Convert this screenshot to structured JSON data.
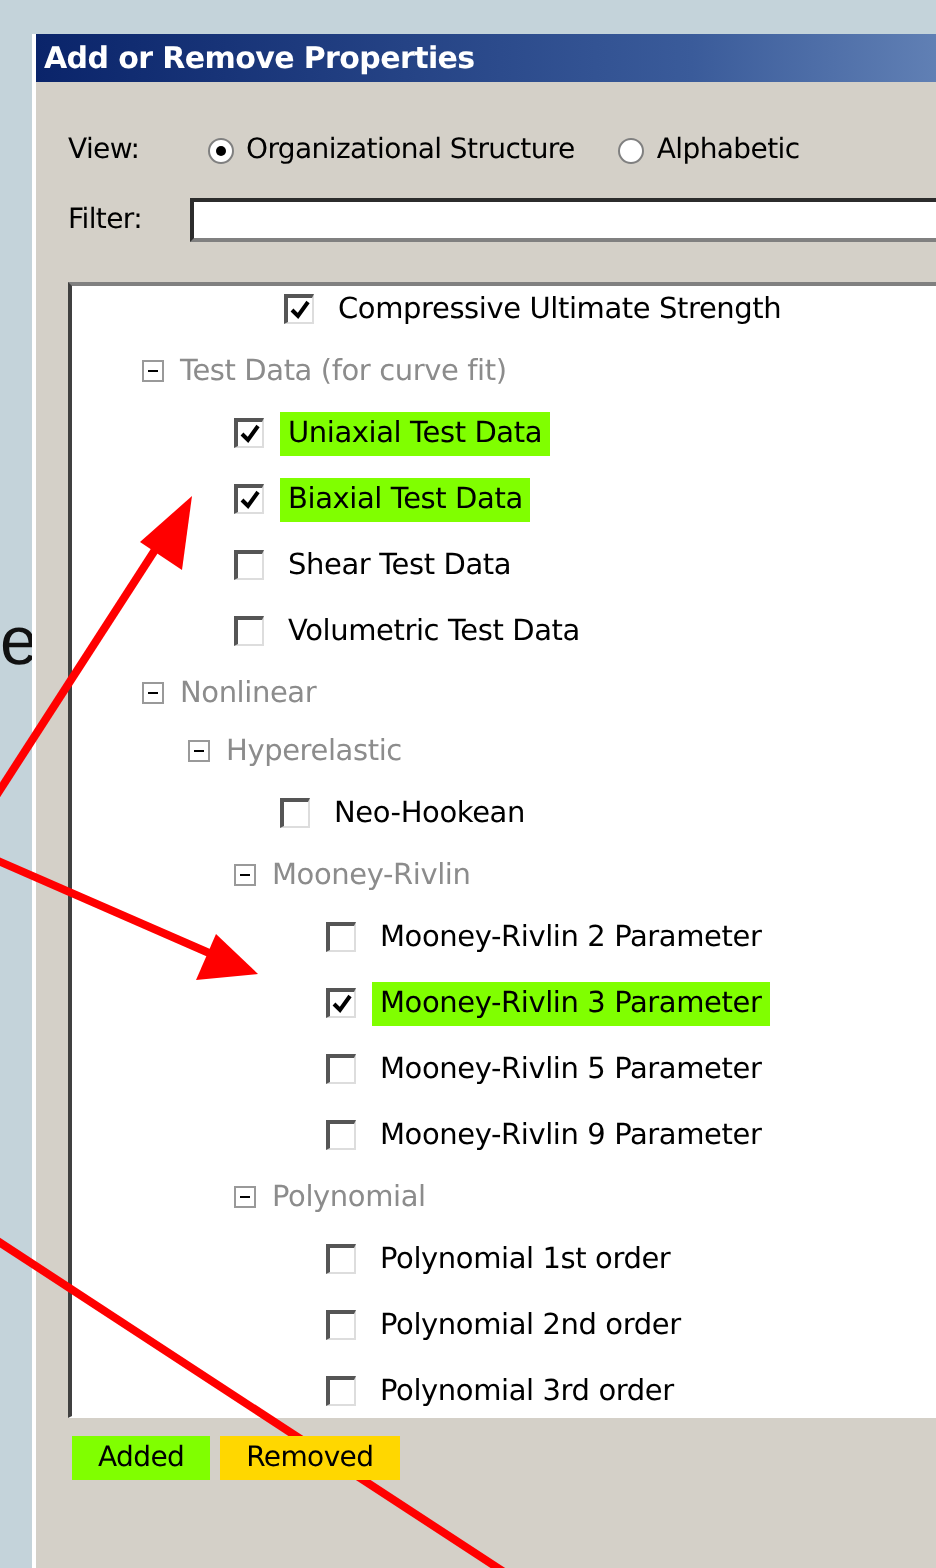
{
  "slide_text": "e",
  "window": {
    "title": "Add or Remove Properties"
  },
  "view": {
    "label": "View:",
    "options": [
      {
        "label": "Organizational Structure",
        "selected": true
      },
      {
        "label": "Alphabetic",
        "selected": false
      }
    ]
  },
  "filter": {
    "label": "Filter:"
  },
  "tree": [
    {
      "kind": "check",
      "label": "Compressive Ultimate Strength",
      "checked": true,
      "added": false
    },
    {
      "kind": "group",
      "label": "Test Data (for curve fit)",
      "expanded": true,
      "children": [
        {
          "kind": "check",
          "label": "Uniaxial Test Data",
          "checked": true,
          "added": true
        },
        {
          "kind": "check",
          "label": "Biaxial Test Data",
          "checked": true,
          "added": true
        },
        {
          "kind": "check",
          "label": "Shear Test Data",
          "checked": false,
          "added": false
        },
        {
          "kind": "check",
          "label": "Volumetric Test Data",
          "checked": false,
          "added": false
        }
      ]
    },
    {
      "kind": "group",
      "label": "Nonlinear",
      "expanded": true,
      "children": [
        {
          "kind": "group",
          "label": "Hyperelastic",
          "expanded": true,
          "children": [
            {
              "kind": "check",
              "label": "Neo-Hookean",
              "checked": false,
              "added": false
            },
            {
              "kind": "group",
              "label": "Mooney-Rivlin",
              "expanded": true,
              "children": [
                {
                  "kind": "check",
                  "label": "Mooney-Rivlin 2 Parameter",
                  "checked": false,
                  "added": false
                },
                {
                  "kind": "check",
                  "label": "Mooney-Rivlin 3 Parameter",
                  "checked": true,
                  "added": true
                },
                {
                  "kind": "check",
                  "label": "Mooney-Rivlin 5 Parameter",
                  "checked": false,
                  "added": false
                },
                {
                  "kind": "check",
                  "label": "Mooney-Rivlin 9 Parameter",
                  "checked": false,
                  "added": false
                }
              ]
            },
            {
              "kind": "group",
              "label": "Polynomial",
              "expanded": true,
              "children": [
                {
                  "kind": "check",
                  "label": "Polynomial 1st order",
                  "checked": false,
                  "added": false
                },
                {
                  "kind": "check",
                  "label": "Polynomial 2nd order",
                  "checked": false,
                  "added": false
                },
                {
                  "kind": "check",
                  "label": "Polynomial 3rd order",
                  "checked": false,
                  "added": false
                }
              ]
            }
          ]
        }
      ]
    }
  ],
  "legend": [
    {
      "label": "Added",
      "color": "#80ff00"
    },
    {
      "label": "Removed",
      "color": "#ffd700"
    }
  ]
}
